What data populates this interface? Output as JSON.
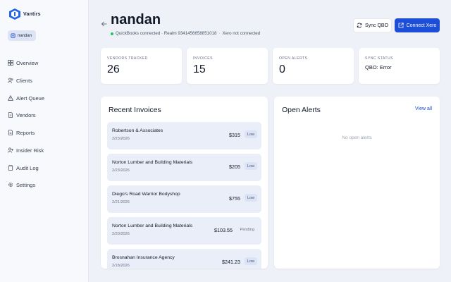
{
  "sidebar": {
    "brand": "Vantirs",
    "user": "nandan",
    "items": [
      {
        "label": "Overview",
        "icon": "grid-icon"
      },
      {
        "label": "Clients",
        "icon": "users-icon"
      },
      {
        "label": "Alert Queue",
        "icon": "alert-triangle-icon"
      },
      {
        "label": "Vendors",
        "icon": "document-icon"
      },
      {
        "label": "Reports",
        "icon": "document-icon"
      },
      {
        "label": "Insider Risk",
        "icon": "user-plus-icon"
      },
      {
        "label": "Audit Log",
        "icon": "clipboard-icon"
      },
      {
        "label": "Settings",
        "icon": "gear-icon"
      }
    ]
  },
  "header": {
    "title": "nandan",
    "qbo_status": "QuickBooks connected · Realm 9341456658851018",
    "xero_status": "Xero not connected",
    "sync_label": "Sync QBO",
    "connect_label": "Connect Xero"
  },
  "stats": [
    {
      "label": "VENDORS TRACKED",
      "value": "26"
    },
    {
      "label": "INVOICES",
      "value": "15"
    },
    {
      "label": "OPEN ALERTS",
      "value": "0"
    },
    {
      "label": "SYNC STATUS",
      "value": "QBO: Error"
    }
  ],
  "invoices": {
    "title": "Recent Invoices",
    "rows": [
      {
        "vendor": "Robertson & Associates",
        "date": "2/23/2026",
        "amount": "$315",
        "status": "Low"
      },
      {
        "vendor": "Norton Lumber and Building Materials",
        "date": "2/23/2026",
        "amount": "$205",
        "status": "Low"
      },
      {
        "vendor": "Diego's Road Warrior Bodyshop",
        "date": "2/21/2026",
        "amount": "$755",
        "status": "Low"
      },
      {
        "vendor": "Norton Lumber and Building Materials",
        "date": "2/20/2026",
        "amount": "$103.55",
        "status": "Pending"
      },
      {
        "vendor": "Brosnahan Insurance Agency",
        "date": "2/18/2026",
        "amount": "$241.23",
        "status": "Low"
      }
    ]
  },
  "alerts": {
    "title": "Open Alerts",
    "view_all": "View all",
    "empty": "No open alerts"
  },
  "colors": {
    "accent": "#1d4ed8",
    "connected_dot": "#22c55e"
  }
}
